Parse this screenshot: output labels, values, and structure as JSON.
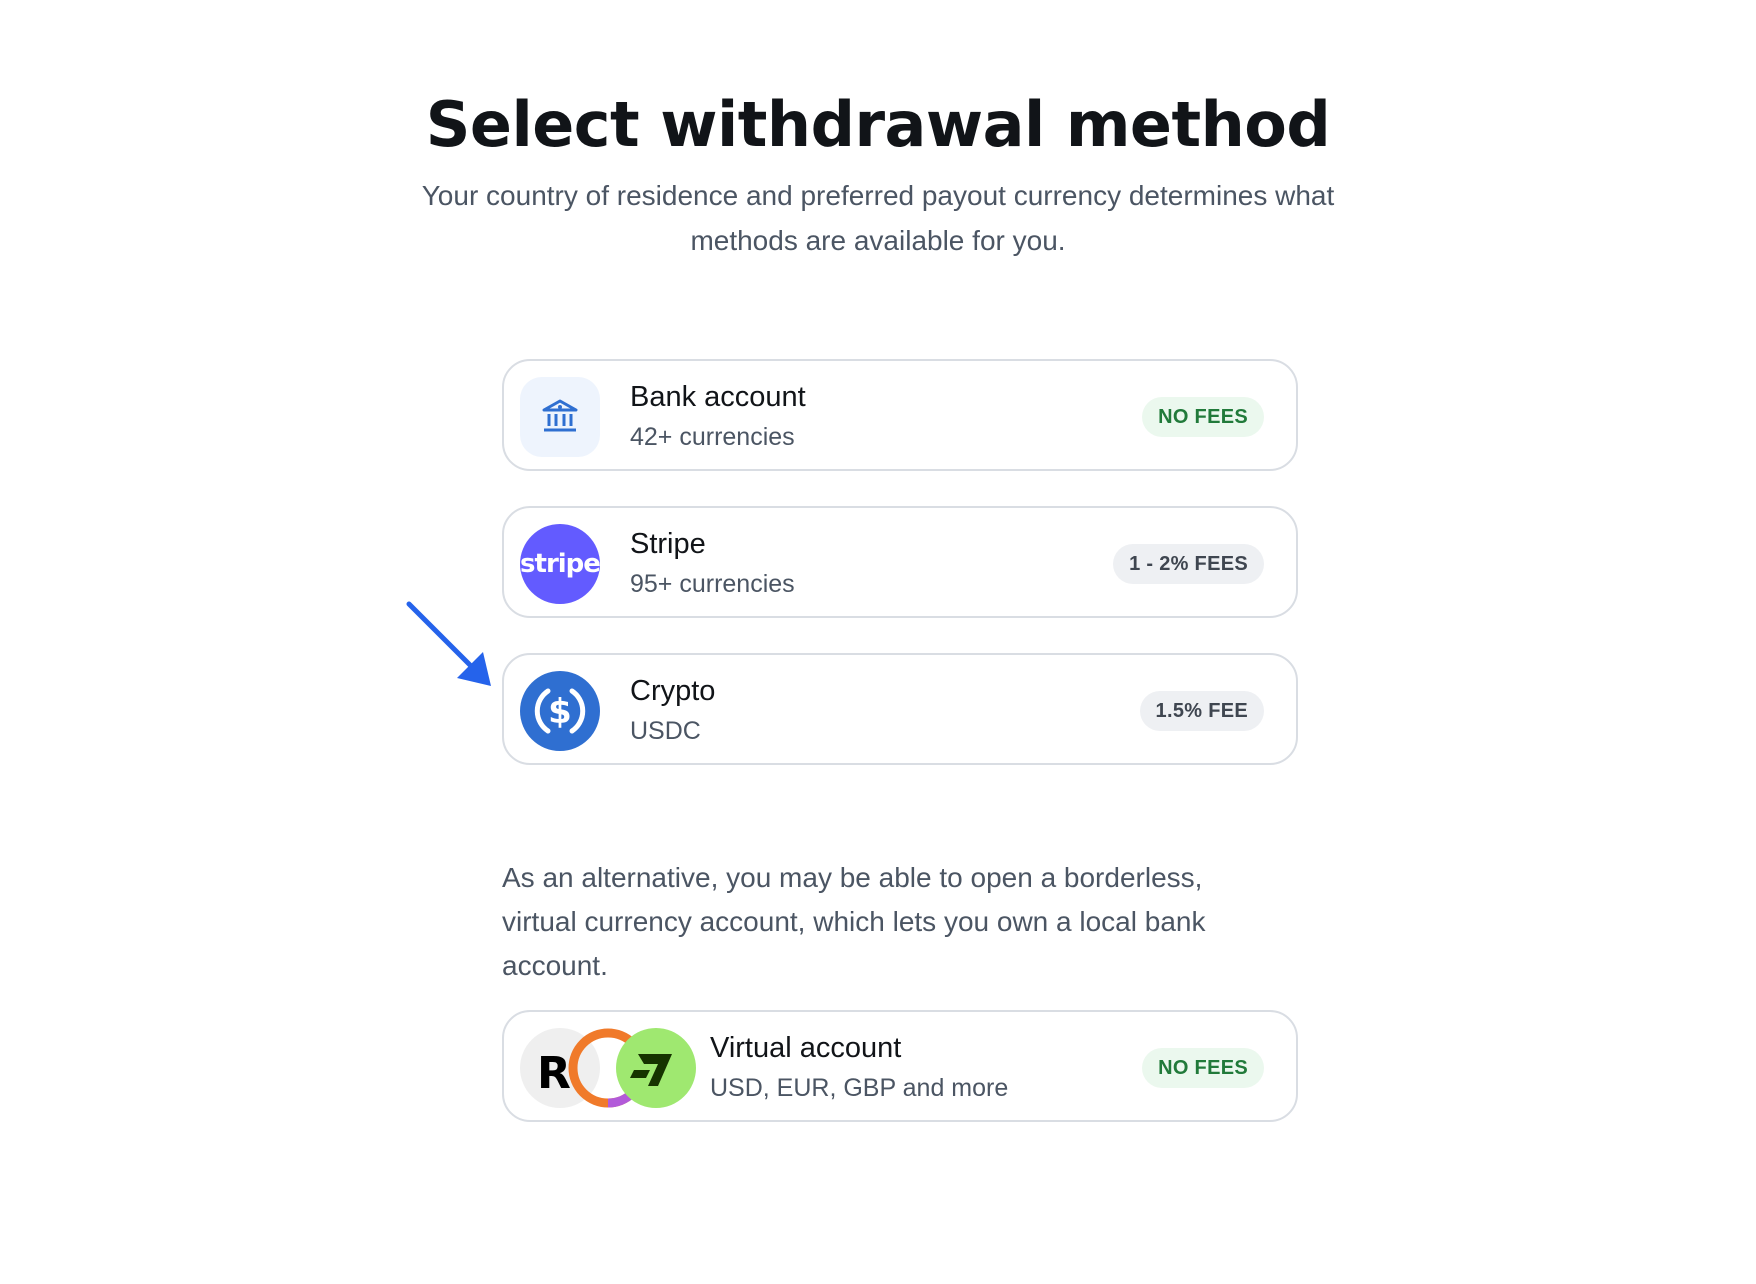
{
  "header": {
    "title": "Select withdrawal method",
    "subtitle": "Your country of residence and preferred payout currency determines what methods are available for you."
  },
  "methods": [
    {
      "name": "Bank account",
      "sub": "42+ currencies",
      "fee": "NO FEES",
      "icon": "bank-icon",
      "color": "#2f6fd1"
    },
    {
      "name": "Stripe",
      "sub": "95+ currencies",
      "fee": "1 - 2% FEES",
      "icon": "stripe-logo",
      "logo_text": "stripe",
      "color": "#635bff"
    },
    {
      "name": "Crypto",
      "sub": "USDC",
      "fee": "1.5% FEE",
      "icon": "usdc-icon",
      "color": "#2f6fd1"
    }
  ],
  "alternative": {
    "text": "As an alternative, you may be able to open a borderless, virtual currency account, which lets you own a local bank account.",
    "card": {
      "name": "Virtual account",
      "sub": "USD, EUR, GBP and more",
      "fee": "NO FEES",
      "icons": [
        "revolut-logo",
        "ring-logo",
        "wise-logo"
      ]
    }
  },
  "annotation": {
    "icon": "arrow-pointer-icon",
    "color": "#2563eb"
  }
}
